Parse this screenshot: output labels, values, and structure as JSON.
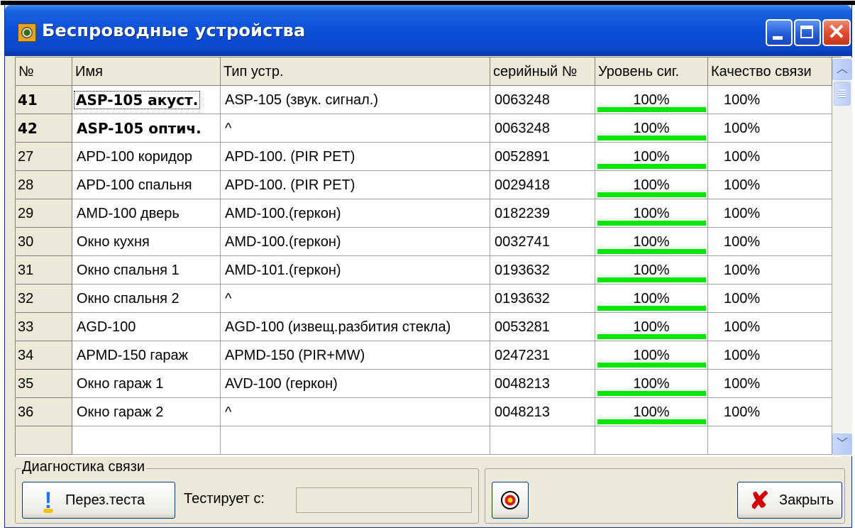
{
  "window": {
    "title": "Беспроводные устройства"
  },
  "columns": [
    "№",
    "Имя",
    "Тип устр.",
    "серийный №",
    "Уровень сиг.",
    "Качество связи"
  ],
  "rows": [
    {
      "num": "41",
      "name": "ASP-105 акуст.",
      "type": "ASP-105 (звук. сигнал.)",
      "serial": "0063248",
      "signal": "100%",
      "signal_level": 100,
      "quality": "100%",
      "bold": true,
      "focused": true
    },
    {
      "num": "42",
      "name": "ASP-105 оптич.",
      "type": "^",
      "serial": "0063248",
      "signal": "100%",
      "signal_level": 100,
      "quality": "100%",
      "bold": true
    },
    {
      "num": "27",
      "name": "APD-100 коридор",
      "type": "APD-100. (PIR PET)",
      "serial": "0052891",
      "signal": "100%",
      "signal_level": 100,
      "quality": "100%"
    },
    {
      "num": "28",
      "name": "APD-100 спальня",
      "type": "APD-100. (PIR PET)",
      "serial": "0029418",
      "signal": "100%",
      "signal_level": 100,
      "quality": "100%"
    },
    {
      "num": "29",
      "name": "AMD-100 дверь",
      "type": "AMD-100.(геркон)",
      "serial": "0182239",
      "signal": "100%",
      "signal_level": 100,
      "quality": "100%"
    },
    {
      "num": "30",
      "name": "Окно кухня",
      "type": "AMD-100.(геркон)",
      "serial": "0032741",
      "signal": "100%",
      "signal_level": 100,
      "quality": "100%"
    },
    {
      "num": "31",
      "name": "Окно спальня 1",
      "type": "AMD-101.(геркон)",
      "serial": "0193632",
      "signal": "100%",
      "signal_level": 100,
      "quality": "100%"
    },
    {
      "num": "32",
      "name": "Окно спальня 2",
      "type": "^",
      "serial": "0193632",
      "signal": "100%",
      "signal_level": 100,
      "quality": "100%"
    },
    {
      "num": "33",
      "name": "AGD-100",
      "type": "AGD-100 (извещ.разбития стекла)",
      "serial": "0053281",
      "signal": "100%",
      "signal_level": 100,
      "quality": "100%"
    },
    {
      "num": "34",
      "name": "APMD-150 гараж",
      "type": "APMD-150 (PIR+MW)",
      "serial": "0247231",
      "signal": "100%",
      "signal_level": 100,
      "quality": "100%"
    },
    {
      "num": "35",
      "name": "Окно гараж 1",
      "type": "AVD-100 (геркон)",
      "serial": "0048213",
      "signal": "100%",
      "signal_level": 100,
      "quality": "100%"
    },
    {
      "num": "36",
      "name": "Окно гараж 2",
      "type": "^",
      "serial": "0048213",
      "signal": "100%",
      "signal_level": 100,
      "quality": "100%"
    }
  ],
  "diagnostics": {
    "group_label": "Диагностика связи",
    "test_button": "Перез.теста",
    "testing_label": "Тестирует с:",
    "testing_value": ""
  },
  "close_button": "Закрыть",
  "icons": {
    "app": "wireless-devices-icon",
    "test": "exclamation-icon",
    "signal": "signal-test-icon",
    "close": "red-x-icon"
  },
  "colors": {
    "signal_bar": "#00e600",
    "title_bar": "#0b4fd8",
    "close_x": "#d40000"
  }
}
